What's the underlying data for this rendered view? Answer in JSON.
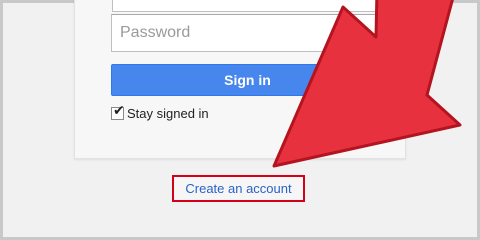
{
  "login_form": {
    "password_placeholder": "Password",
    "signin_label": "Sign in",
    "stay_signed_in_label": "Stay signed in",
    "stay_signed_in_checked": true
  },
  "footer": {
    "create_account_label": "Create an account"
  },
  "annotation": {
    "arrow_color": "#e8313f",
    "highlight_color": "#d4001a"
  },
  "colors": {
    "signin_button": "#4787ed",
    "link": "#2a62c7"
  }
}
